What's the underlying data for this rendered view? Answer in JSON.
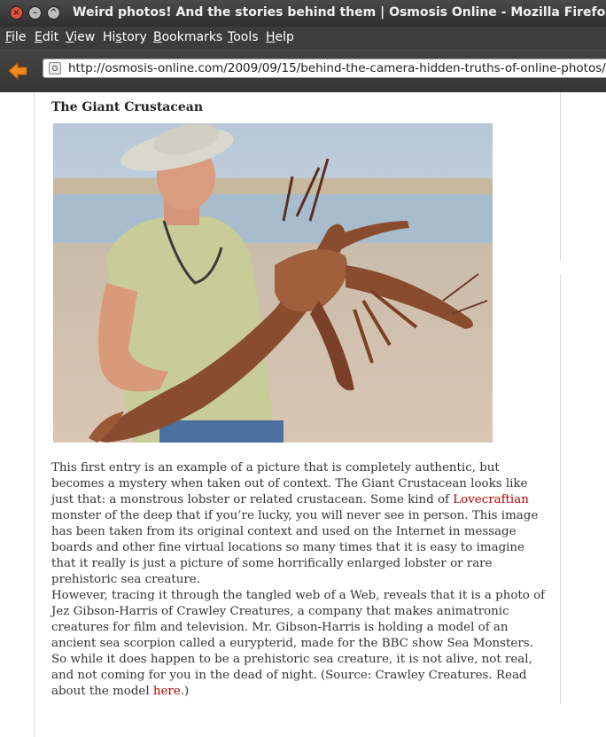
{
  "window": {
    "title": "Weird photos! And the stories behind them | Osmosis Online - Mozilla Firefox"
  },
  "menu": {
    "items": [
      {
        "label": "File",
        "mnemonic": "F",
        "rest": "ile"
      },
      {
        "label": "Edit",
        "mnemonic": "E",
        "rest": "dit"
      },
      {
        "label": "View",
        "mnemonic": "V",
        "rest": "iew"
      },
      {
        "label": "History",
        "pre": "Hi",
        "mnemonic": "s",
        "rest": "tory"
      },
      {
        "label": "Bookmarks",
        "mnemonic": "B",
        "rest": "ookmarks"
      },
      {
        "label": "Tools",
        "mnemonic": "T",
        "rest": "ools"
      },
      {
        "label": "Help",
        "mnemonic": "H",
        "rest": "elp"
      }
    ]
  },
  "navbar": {
    "url": "http://osmosis-online.com/2009/09/15/behind-the-camera-hidden-truths-of-online-photos/"
  },
  "article": {
    "heading": "The Giant Crustacean",
    "p1_before_link": "This first entry is an example of a picture that is completely authentic, but becomes a mystery when taken out of context. The Giant Crustacean looks like just that: a monstrous lobster or related crustacean. Some kind of ",
    "p1_link": "Lovecraftian",
    "p1_after_link": " monster of the deep that if you’re lucky, you will never see in person. This image has been taken from its original context and used on the Internet in message boards and other fine virtual locations so many times that it is easy to imagine that it really is just a picture of some horrifically enlarged lobster or rare prehistoric sea creature.",
    "p2_before_link": "However, tracing it through the tangled web of a Web, reveals that it is a photo of Jez Gibson-Harris of Crawley Creatures, a company that makes animatronic creatures for film and television. Mr. Gibson-Harris is holding a model of an ancient sea scorpion called a eurypterid, made for the BBC show Sea Monsters. So while it does happen to be a prehistoric sea creature, it is not alive, not real, and not coming for you in the dead of night. (Source: Crawley Creatures. Read about the model ",
    "p2_link": "here",
    "p2_after_link": ".)"
  }
}
